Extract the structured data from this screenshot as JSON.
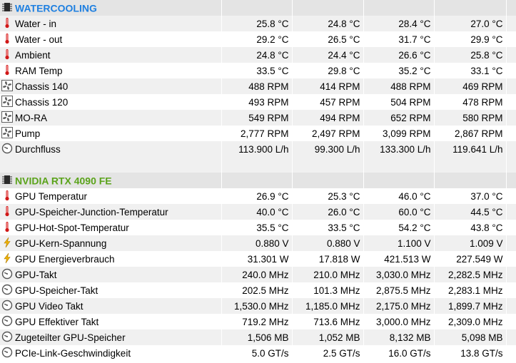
{
  "colors": {
    "watercooling_title": "#1e7fe0",
    "nvidia_title": "#5aa31a",
    "thermo_red": "#d01818",
    "fan_gray": "#606060",
    "bolt_yellow": "#f0b400",
    "gauge_gray": "#555555"
  },
  "sections": [
    {
      "title": "WATERCOOLING",
      "rows": [
        {
          "icon": "thermometer-icon",
          "label": "Water - in",
          "values": [
            "25.8 °C",
            "24.8 °C",
            "28.4 °C",
            "27.0 °C"
          ]
        },
        {
          "icon": "thermometer-icon",
          "label": "Water - out",
          "values": [
            "29.2 °C",
            "26.5 °C",
            "31.7 °C",
            "29.9 °C"
          ]
        },
        {
          "icon": "thermometer-icon",
          "label": "Ambient",
          "values": [
            "24.8 °C",
            "24.4 °C",
            "26.6 °C",
            "25.8 °C"
          ]
        },
        {
          "icon": "thermometer-icon",
          "label": "RAM Temp",
          "values": [
            "33.5 °C",
            "29.8 °C",
            "35.2 °C",
            "33.1 °C"
          ]
        },
        {
          "icon": "fan-icon",
          "label": "Chassis 140",
          "values": [
            "488 RPM",
            "414 RPM",
            "488 RPM",
            "469 RPM"
          ]
        },
        {
          "icon": "fan-icon",
          "label": "Chassis 120",
          "values": [
            "493 RPM",
            "457 RPM",
            "504 RPM",
            "478 RPM"
          ]
        },
        {
          "icon": "fan-icon",
          "label": "MO-RA",
          "values": [
            "549 RPM",
            "494 RPM",
            "652 RPM",
            "580 RPM"
          ]
        },
        {
          "icon": "fan-icon",
          "label": "Pump",
          "values": [
            "2,777 RPM",
            "2,497 RPM",
            "3,099 RPM",
            "2,867 RPM"
          ]
        },
        {
          "icon": "gauge-icon",
          "label": "Durchfluss",
          "values": [
            "113.900 L/h",
            "99.300 L/h",
            "133.300 L/h",
            "119.641 L/h"
          ]
        }
      ]
    },
    {
      "title": "NVIDIA RTX 4090 FE",
      "rows": [
        {
          "icon": "thermometer-icon",
          "label": "GPU Temperatur",
          "values": [
            "26.9 °C",
            "25.3 °C",
            "46.0 °C",
            "37.0 °C"
          ]
        },
        {
          "icon": "thermometer-icon",
          "label": "GPU-Speicher-Junction-Temperatur",
          "values": [
            "40.0 °C",
            "26.0 °C",
            "60.0 °C",
            "44.5 °C"
          ]
        },
        {
          "icon": "thermometer-icon",
          "label": "GPU-Hot-Spot-Temperatur",
          "values": [
            "35.5 °C",
            "33.5 °C",
            "54.2 °C",
            "43.8 °C"
          ]
        },
        {
          "icon": "bolt-icon",
          "label": "GPU-Kern-Spannung",
          "values": [
            "0.880 V",
            "0.880 V",
            "1.100 V",
            "1.009 V"
          ]
        },
        {
          "icon": "bolt-icon",
          "label": "GPU Energieverbrauch",
          "values": [
            "31.301 W",
            "17.818 W",
            "421.513 W",
            "227.549 W"
          ]
        },
        {
          "icon": "gauge-icon",
          "label": "GPU-Takt",
          "values": [
            "240.0 MHz",
            "210.0 MHz",
            "3,030.0 MHz",
            "2,282.5 MHz"
          ]
        },
        {
          "icon": "gauge-icon",
          "label": "GPU-Speicher-Takt",
          "values": [
            "202.5 MHz",
            "101.3 MHz",
            "2,875.5 MHz",
            "2,283.1 MHz"
          ]
        },
        {
          "icon": "gauge-icon",
          "label": "GPU Video Takt",
          "values": [
            "1,530.0 MHz",
            "1,185.0 MHz",
            "2,175.0 MHz",
            "1,899.7 MHz"
          ]
        },
        {
          "icon": "gauge-icon",
          "label": "GPU Effektiver Takt",
          "values": [
            "719.2 MHz",
            "713.6 MHz",
            "3,000.0 MHz",
            "2,309.0 MHz"
          ]
        },
        {
          "icon": "gauge-icon",
          "label": "Zugeteilter GPU-Speicher",
          "values": [
            "1,506 MB",
            "1,052 MB",
            "8,132 MB",
            "5,098 MB"
          ]
        },
        {
          "icon": "gauge-icon",
          "label": "PCIe-Link-Geschwindigkeit",
          "values": [
            "5.0 GT/s",
            "2.5 GT/s",
            "16.0 GT/s",
            "13.8 GT/s"
          ]
        }
      ]
    }
  ]
}
